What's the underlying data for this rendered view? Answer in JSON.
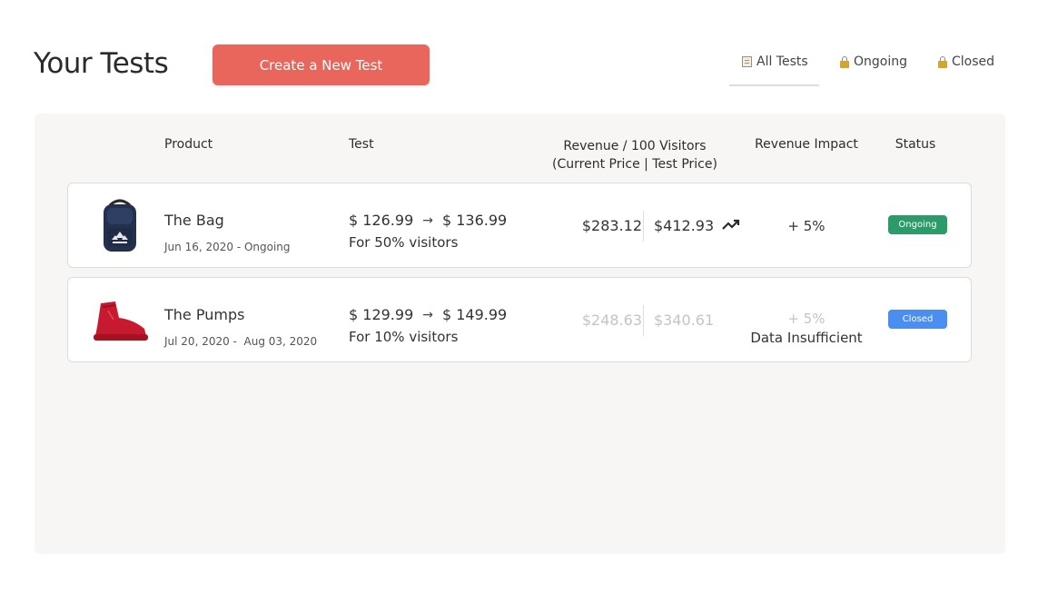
{
  "header": {
    "title": "Your Tests",
    "create_button": "Create a New Test",
    "tabs": [
      {
        "label": "All Tests",
        "icon": "document-icon",
        "active": true
      },
      {
        "label": "Ongoing",
        "icon": "lock-icon"
      },
      {
        "label": "Closed",
        "icon": "lock-icon"
      }
    ]
  },
  "table": {
    "columns": {
      "product": "Product",
      "test": "Test",
      "revenue": "Revenue / 100 Visitors",
      "revenue_sub": "(Current Price | Test Price)",
      "impact": "Revenue Impact",
      "status": "Status"
    },
    "rows": [
      {
        "product": "The Bag",
        "image": "backpack-image",
        "date": "Jun 16, 2020 - Ongoing",
        "current_price": "$ 126.99",
        "test_price": "$ 136.99",
        "visitors": "For 50% visitors",
        "revenue_current": "$283.12",
        "revenue_test": "$412.93",
        "trend_icon": "trending-up-icon",
        "impact": "+ 5%",
        "status": "Ongoing",
        "status_color": "#2b9b69"
      },
      {
        "product": "The Pumps",
        "image": "red-boot-image",
        "date": "Jul 20, 2020 -  Aug 03, 2020",
        "current_price": "$ 129.99",
        "test_price": "$ 149.99",
        "visitors": "For 10% visitors",
        "revenue_current": "$248.63",
        "revenue_test": "$340.61",
        "impact": "+ 5%",
        "impact_note": "Data Insufficient",
        "status": "Closed",
        "status_color": "#4a8ff0"
      }
    ]
  },
  "colors": {
    "accent": "#e8665b",
    "panel_bg": "#f8f6f4",
    "muted_text": "#c4c4c4"
  }
}
